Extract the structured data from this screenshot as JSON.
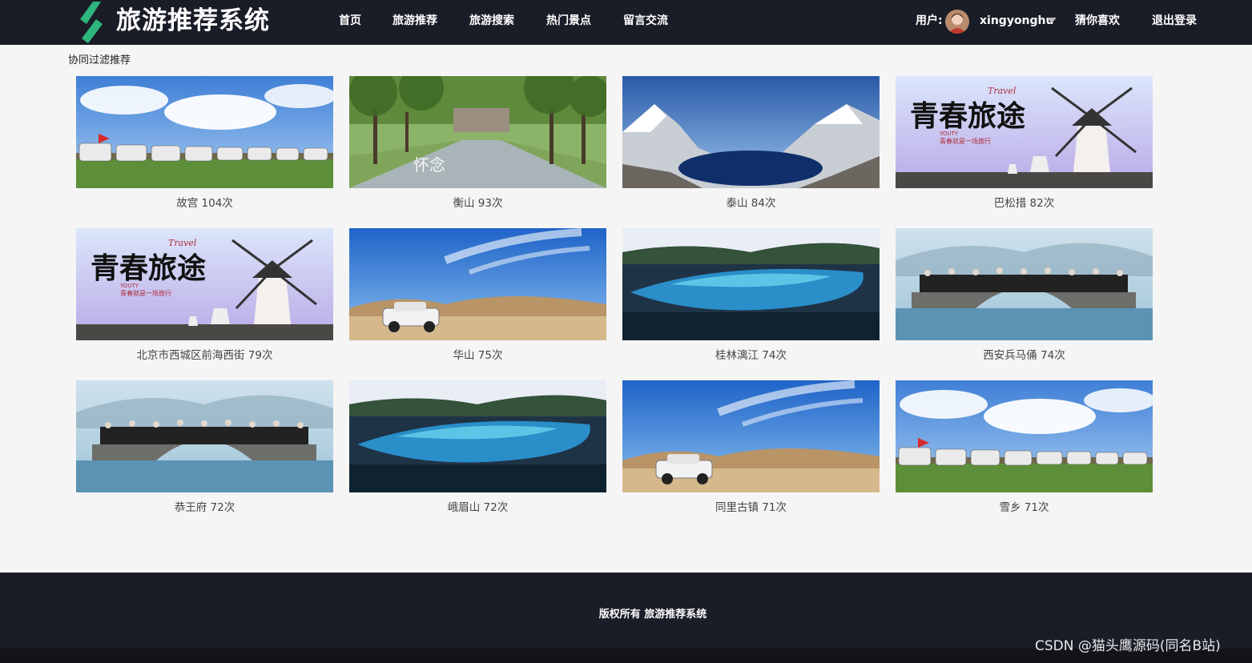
{
  "header": {
    "title": "旅游推荐系统",
    "nav": [
      "首页",
      "旅游推荐",
      "旅游搜索",
      "热门景点",
      "留言交流"
    ],
    "user_label": "用户:",
    "username": "xingyonghu",
    "guess": "猜你喜欢",
    "logout": "退出登录"
  },
  "main": {
    "section_title": "协同过滤推荐",
    "cards": [
      {
        "caption": "故宫 104次",
        "image": "cars-meadow"
      },
      {
        "caption": "衡山 93次",
        "image": "tree-avenue"
      },
      {
        "caption": "泰山 84次",
        "image": "snow-mountain-lake"
      },
      {
        "caption": "巴松措 82次",
        "image": "windmill-travel"
      },
      {
        "caption": "北京市西城区前海西街 79次",
        "image": "windmill-travel"
      },
      {
        "caption": "华山 75次",
        "image": "desert-car"
      },
      {
        "caption": "桂林漓江 74次",
        "image": "blue-lake"
      },
      {
        "caption": "西安兵马俑 74次",
        "image": "stone-bridge"
      },
      {
        "caption": "恭王府 72次",
        "image": "stone-bridge"
      },
      {
        "caption": "峨眉山 72次",
        "image": "blue-lake"
      },
      {
        "caption": "同里古镇 71次",
        "image": "desert-car"
      },
      {
        "caption": "雪乡 71次",
        "image": "cars-meadow"
      }
    ],
    "image_text": {
      "travel": "Travel",
      "youth": "青春旅途",
      "youty": "YOUTY",
      "sub": "青春就是一场旅行",
      "miss": "怀念"
    }
  },
  "footer": {
    "copyright": "版权所有 旅游推荐系统",
    "watermark": "CSDN @猫头鹰源码(同名B站)"
  },
  "colors": {
    "header_bg": "#1a1d28",
    "logo": "#2fb57e",
    "page_bg": "#f5f5f5"
  }
}
